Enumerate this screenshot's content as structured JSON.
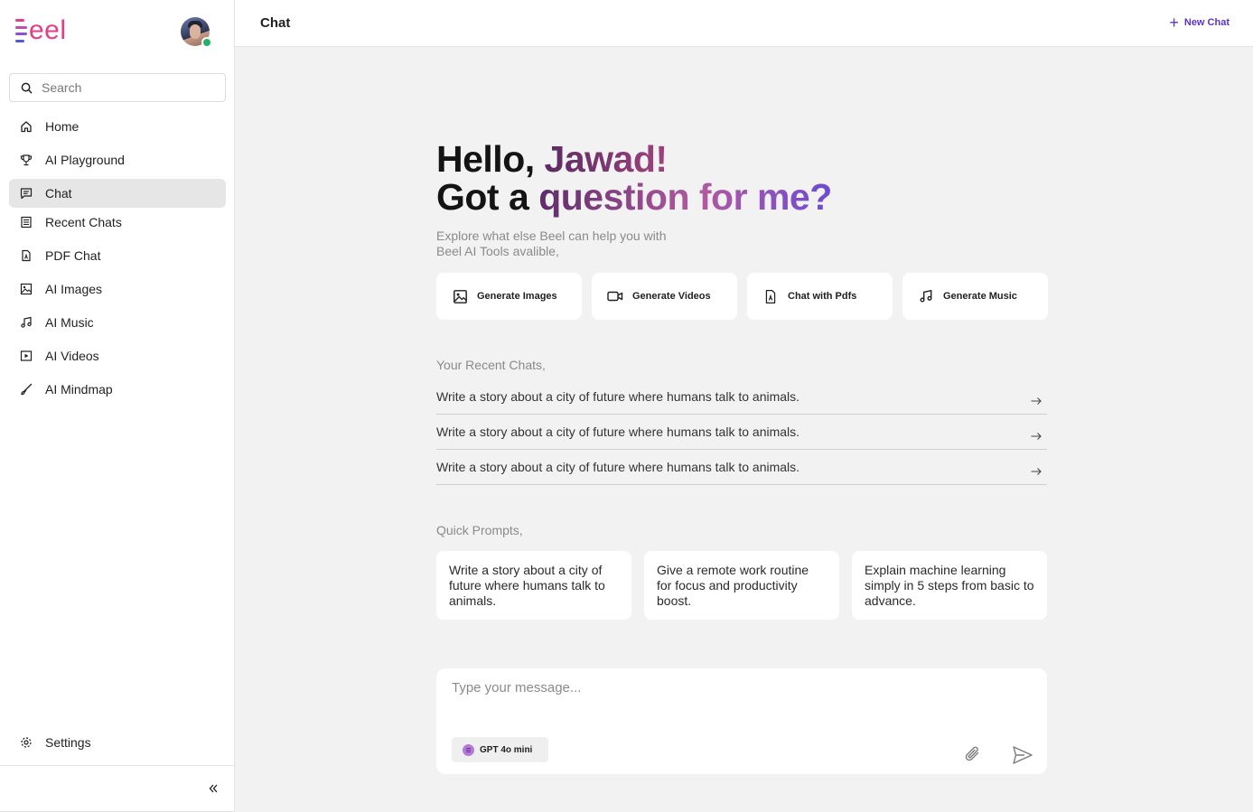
{
  "app": {
    "logo_text": "eel",
    "logo_colors": [
      "#e23f8a",
      "#c24bb0",
      "#8e4fd0",
      "#5a57d6"
    ]
  },
  "sidebar": {
    "search_placeholder": "Search",
    "items": [
      {
        "label": "Home",
        "icon": "home-icon"
      },
      {
        "label": "AI Playground",
        "icon": "trophy-icon"
      },
      {
        "label": "Chat",
        "icon": "chat-icon",
        "active": true
      },
      {
        "label": "Recent Chats",
        "icon": "list-icon"
      },
      {
        "label": "PDF Chat",
        "icon": "pdf-icon"
      },
      {
        "label": "AI Images",
        "icon": "image-icon"
      },
      {
        "label": "AI Music",
        "icon": "music-icon"
      },
      {
        "label": "AI Videos",
        "icon": "video-icon"
      },
      {
        "label": "AI Mindmap",
        "icon": "brush-icon"
      }
    ],
    "settings_label": "Settings"
  },
  "header": {
    "title": "Chat",
    "new_chat_label": "New Chat"
  },
  "hero": {
    "hello": "Hello, ",
    "name": "Jawad!",
    "got": "Got a ",
    "question": "question for me?",
    "sub_line1": "Explore what else Beel can help you with",
    "sub_line2": "Beel AI Tools avalible,"
  },
  "tools": [
    {
      "label": "Generate Images",
      "icon": "image-icon"
    },
    {
      "label": "Generate Videos",
      "icon": "video-icon"
    },
    {
      "label": "Chat with Pdfs",
      "icon": "pdf-icon"
    },
    {
      "label": "Generate Music",
      "icon": "music-icon"
    }
  ],
  "recent": {
    "title": "Your Recent Chats,",
    "items": [
      "Write a story about a city of future where humans talk to animals.",
      "Write a story about a city of future where humans talk to animals.",
      "Write a story about a city of future where humans talk to animals."
    ]
  },
  "quick": {
    "title": "Quick Prompts,",
    "items": [
      "Write a story about a city of future where humans talk to animals.",
      "Give a remote work routine for focus and productivity boost.",
      "Explain machine learning simply in 5 steps from basic to advance."
    ]
  },
  "composer": {
    "placeholder": "Type your message...",
    "model_label": "GPT 4o mini"
  },
  "colors": {
    "accent": "#5b34c7",
    "online": "#22b26b",
    "active_bg": "#e6e6e6"
  }
}
